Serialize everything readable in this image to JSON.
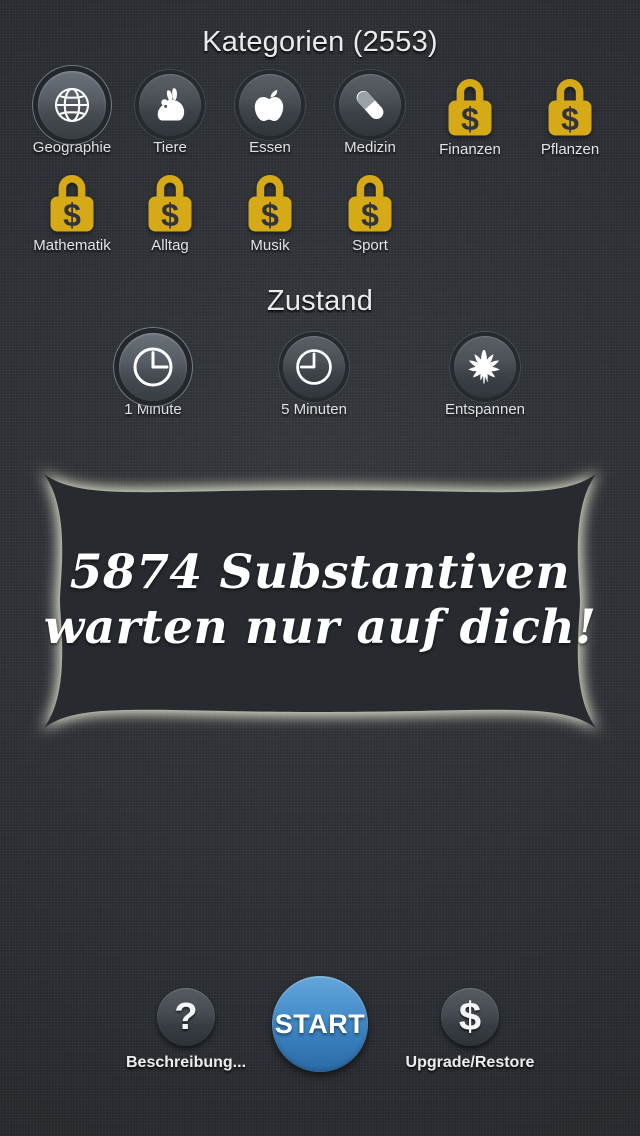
{
  "theme": {
    "background": "#2d3135",
    "lock_color": "#d6a916",
    "accent_blue": "#3a81bf",
    "text_color": "#e8eaec",
    "banner_glow": "#e8e7d2"
  },
  "categories_section": {
    "title": "Kategorien (2553)",
    "count": 2553,
    "rows": [
      [
        {
          "label": "Geographie",
          "icon": "globe-icon",
          "locked": false,
          "selected": true
        },
        {
          "label": "Tiere",
          "icon": "rabbit-icon",
          "locked": false,
          "selected": false
        },
        {
          "label": "Essen",
          "icon": "apple-icon",
          "locked": false,
          "selected": false
        },
        {
          "label": "Medizin",
          "icon": "pill-icon",
          "locked": false,
          "selected": false
        },
        {
          "label": "Finanzen",
          "icon": "lock-dollar-icon",
          "locked": true,
          "selected": false
        },
        {
          "label": "Pflanzen",
          "icon": "lock-dollar-icon",
          "locked": true,
          "selected": false
        }
      ],
      [
        {
          "label": "Mathematik",
          "icon": "lock-dollar-icon",
          "locked": true,
          "selected": false
        },
        {
          "label": "Alltag",
          "icon": "lock-dollar-icon",
          "locked": true,
          "selected": false
        },
        {
          "label": "Musik",
          "icon": "lock-dollar-icon",
          "locked": true,
          "selected": false
        },
        {
          "label": "Sport",
          "icon": "lock-dollar-icon",
          "locked": true,
          "selected": false
        }
      ]
    ]
  },
  "state_section": {
    "title": "Zustand",
    "options": [
      {
        "label": "1 Minute",
        "icon": "clock-3oclock-icon",
        "selected": true
      },
      {
        "label": "5 Minuten",
        "icon": "clock-9oclock-icon",
        "selected": false
      },
      {
        "label": "Entspannen",
        "icon": "leaf-icon",
        "selected": false
      }
    ]
  },
  "banner": {
    "line1": "5874 Substantiven",
    "line2": "warten nur auf dich!",
    "noun_count": 5874
  },
  "bottom_bar": {
    "help": {
      "label": "Beschreibung...",
      "glyph": "?",
      "icon": "question-mark-icon"
    },
    "start": {
      "label": "START"
    },
    "upgrade": {
      "label": "Upgrade/Restore",
      "glyph": "$",
      "icon": "dollar-sign-icon"
    }
  }
}
